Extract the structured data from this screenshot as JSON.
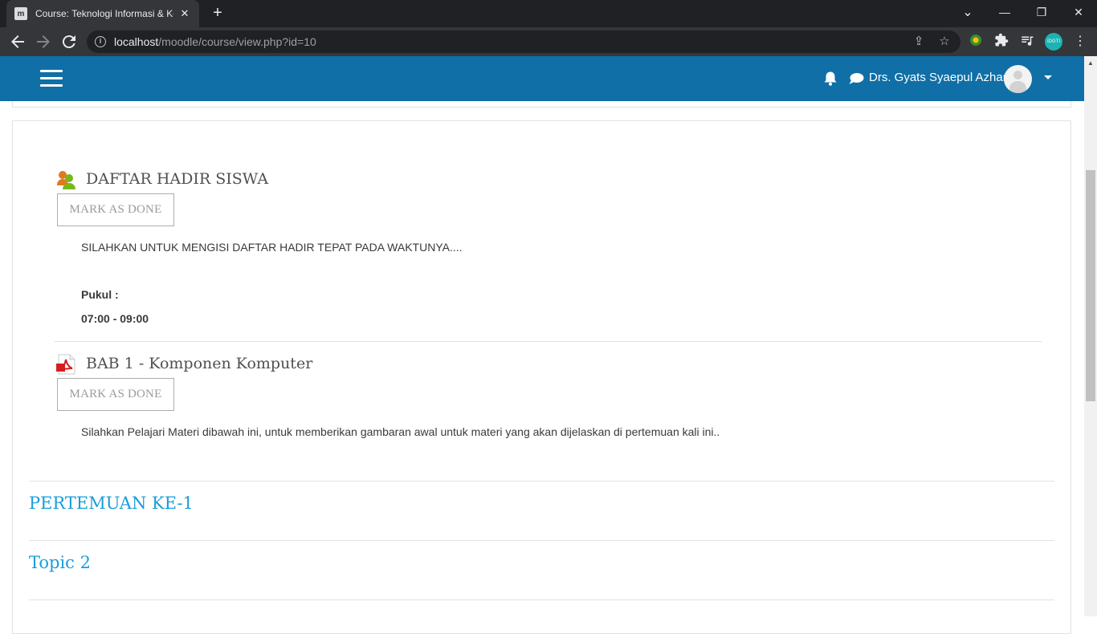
{
  "browser": {
    "tab_title": "Course: Teknologi Informasi & Ko",
    "tab_close": "✕",
    "new_tab": "+",
    "url_host": "localhost",
    "url_path": "/moodle/course/view.php?id=10",
    "window_controls": {
      "minimize": "—",
      "maximize": "❐",
      "close": "✕",
      "tab_search": "⌄"
    }
  },
  "header": {
    "user_name": "Drs. Gyats Syaepul Azhar"
  },
  "activities": [
    {
      "title": "DAFTAR HADIR SISWA",
      "icon": "attendance-icon",
      "button": "MARK AS DONE",
      "description": "SILAHKAN UNTUK MENGISI DAFTAR HADIR TEPAT PADA WAKTUNYA....",
      "time_label": "Pukul :",
      "time_value": "07:00 - 09:00"
    },
    {
      "title": "BAB 1 - Komponen Komputer",
      "icon": "pdf-icon",
      "button": "MARK AS DONE",
      "description": "Silahkan Pelajari Materi dibawah ini, untuk memberikan gambaran awal untuk materi yang akan dijelaskan di pertemuan kali ini.."
    }
  ],
  "sections": [
    {
      "title": "PERTEMUAN KE-1"
    },
    {
      "title": "Topic 2"
    }
  ],
  "colors": {
    "navbar": "#0f6fa6",
    "section_link": "#1a9ddb",
    "browser_dark": "#202124"
  }
}
